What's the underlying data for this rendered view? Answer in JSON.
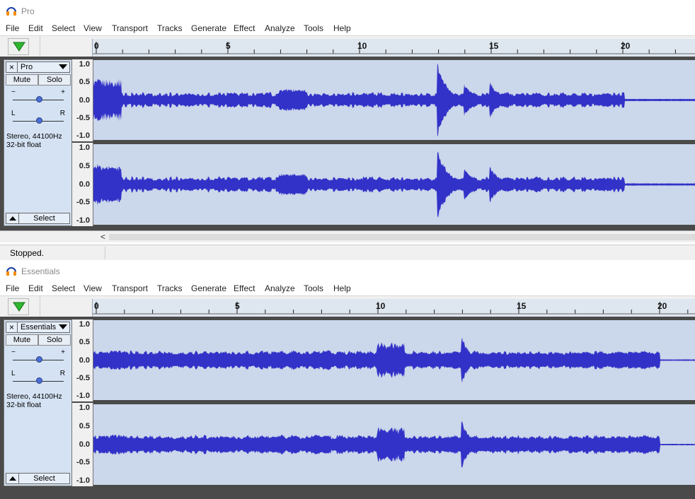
{
  "menu_items": [
    "File",
    "Edit",
    "Select",
    "View",
    "Transport",
    "Tracks",
    "Generate",
    "Effect",
    "Analyze",
    "Tools",
    "Help"
  ],
  "amplitude_labels": [
    "1.0",
    "0.5",
    "0.0",
    "-0.5",
    "-1.0"
  ],
  "timeline_labels": [
    "0",
    "5",
    "10",
    "15",
    "20"
  ],
  "track_common": {
    "close": "×",
    "mute": "Mute",
    "solo": "Solo",
    "pan_left": "L",
    "pan_right": "R",
    "gain_minus": "−",
    "gain_plus": "+",
    "format_line1": "Stereo, 44100Hz",
    "format_line2": "32-bit float",
    "select": "Select"
  },
  "windows": {
    "pro": {
      "title": "Pro",
      "track_name": "Pro",
      "scroll_left": "<",
      "status": "Stopped."
    },
    "essentials": {
      "title": "Essentials",
      "track_name": "Essentials"
    }
  },
  "colors": {
    "waveform": "#3232c8",
    "waveform_bg": "#cbd7ea",
    "track_panel": "#d4e2f3",
    "play": "#2eb82e"
  }
}
